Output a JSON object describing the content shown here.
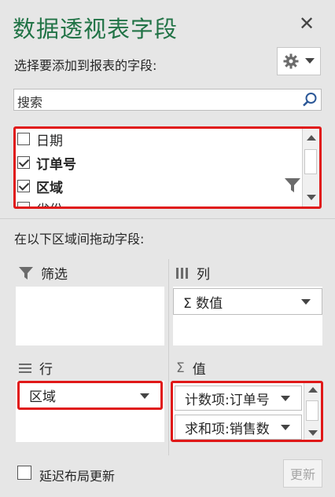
{
  "panel": {
    "title": "数据透视表字段",
    "close_glyph": "✕",
    "subtitle": "选择要添加到报表的字段:",
    "settings_icon": "gear-icon"
  },
  "search": {
    "placeholder": "搜索"
  },
  "fields": [
    {
      "label": "日期",
      "checked": false,
      "bold": false
    },
    {
      "label": "订单号",
      "checked": true,
      "bold": true
    },
    {
      "label": "区域",
      "checked": true,
      "bold": true,
      "filtered": true
    },
    {
      "label": "省份",
      "checked": false,
      "bold": false
    }
  ],
  "drag_label": "在以下区域间拖动字段:",
  "areas": {
    "filters": {
      "label": "筛选",
      "items": []
    },
    "columns": {
      "label": "列",
      "items": [
        {
          "label": "Σ  数值"
        }
      ]
    },
    "rows": {
      "label": "行",
      "items": [
        {
          "label": "区域"
        }
      ]
    },
    "values": {
      "label": "值",
      "items": [
        {
          "label": "计数项:订单号"
        },
        {
          "label": "求和项:销售数"
        }
      ]
    }
  },
  "footer": {
    "defer_label": "延迟布局更新",
    "update_label": "更新"
  },
  "colors": {
    "title": "#217346",
    "highlight": "#e01818",
    "background": "#e6e6e6"
  }
}
